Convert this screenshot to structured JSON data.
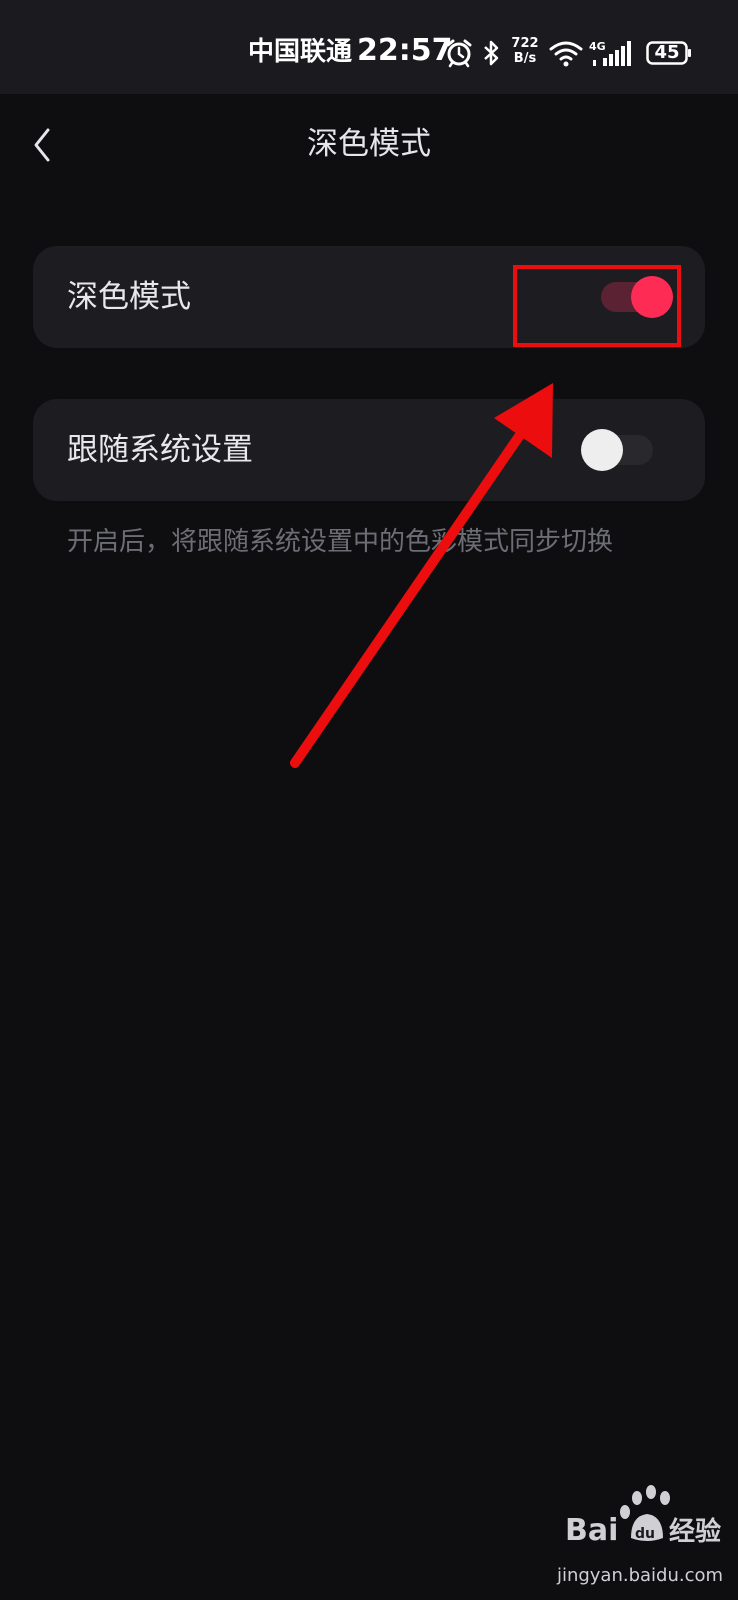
{
  "status_bar": {
    "carrier": "中国联通",
    "time": "22:57",
    "net_speed_value": "722",
    "net_speed_unit": "B/s",
    "network_type": "4G",
    "battery": "45",
    "icons": [
      "alarm-icon",
      "bluetooth-icon",
      "wifi-icon",
      "cellular-signal-icon",
      "battery-icon"
    ]
  },
  "nav": {
    "back_icon": "chevron-left-icon",
    "title": "深色模式"
  },
  "settings": [
    {
      "label": "深色模式",
      "enabled": true
    },
    {
      "label": "跟随系统设置",
      "enabled": false
    }
  ],
  "hint": "开启后，将跟随系统设置中的色彩模式同步切换",
  "colors": {
    "background": "#0e0e11",
    "card": "#1c1c21",
    "accent": "#fe2c55",
    "annotation": "#ec0e0e"
  },
  "watermark": {
    "logo_text": "Bai du 经验",
    "url": "jingyan.baidu.com"
  }
}
